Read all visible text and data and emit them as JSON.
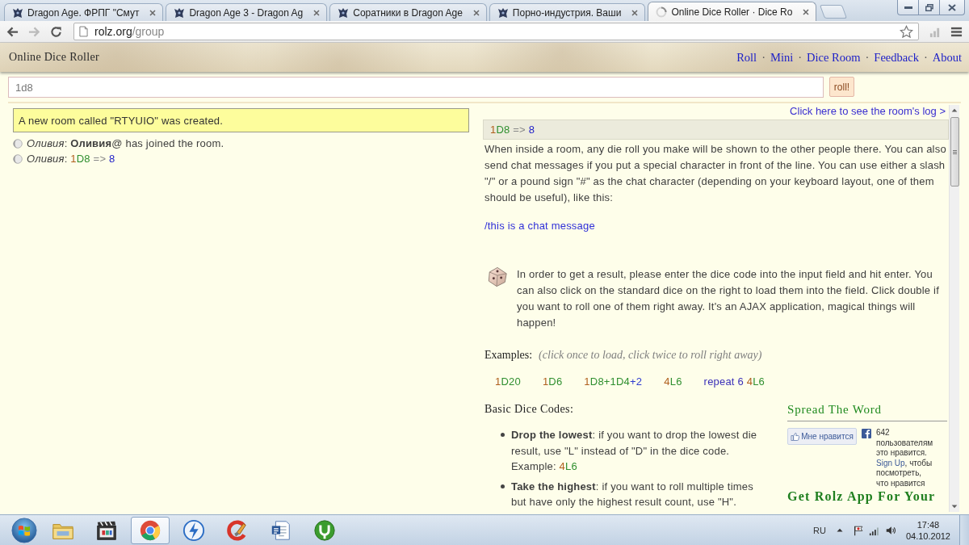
{
  "browser": {
    "tabs": [
      {
        "title": "Dragon Age. ФРПГ \"Смут",
        "selected": false,
        "loading": false
      },
      {
        "title": "Dragon Age 3 - Dragon Ag",
        "selected": false,
        "loading": false
      },
      {
        "title": "Соратники в Dragon Age",
        "selected": false,
        "loading": false
      },
      {
        "title": "Порно-индустрия. Ваши",
        "selected": false,
        "loading": false
      },
      {
        "title": "Online Dice Roller · Dice Ro",
        "selected": true,
        "loading": true
      }
    ],
    "back": {
      "disabled": false
    },
    "forward": {
      "disabled": true
    },
    "url": {
      "host": "rolz.org",
      "path": "/group"
    }
  },
  "header": {
    "title": "Online Dice Roller",
    "nav": [
      {
        "kind": "link",
        "label": "Roll"
      },
      {
        "kind": "separator",
        "label": "·"
      },
      {
        "kind": "link",
        "label": "Mini"
      },
      {
        "kind": "separator",
        "label": "·"
      },
      {
        "kind": "link",
        "label": "Dice Room"
      },
      {
        "kind": "separator",
        "label": "·"
      },
      {
        "kind": "link",
        "label": "Feedback"
      },
      {
        "kind": "separator",
        "label": "·"
      },
      {
        "kind": "link",
        "label": "About"
      }
    ]
  },
  "roll_form": {
    "value": "1d8",
    "button": "roll!"
  },
  "room_log": {
    "notice": "A new room called \"RTYUIO\" was created.",
    "entries": [
      {
        "kind": "join",
        "text": "*Оливия*: **Оливия**@ has joined the room."
      },
      {
        "kind": "roll",
        "prefix": "*Оливия*:",
        "tokens": [
          {
            "kind": "count",
            "text": "1"
          },
          {
            "kind": "die",
            "text": "D8"
          },
          {
            "kind": "operator",
            "text": " => "
          },
          {
            "kind": "result",
            "text": "8"
          }
        ]
      }
    ]
  },
  "info": {
    "log_link": "Click here to see the room's log >",
    "last_roll": [
      {
        "kind": "count",
        "text": "1"
      },
      {
        "kind": "die",
        "text": "D8"
      },
      {
        "kind": "operator",
        "text": " => "
      },
      {
        "kind": "result",
        "text": "8"
      }
    ],
    "intro": "When inside a room, any die roll you make will be shown to the other people there. You can also send chat messages if you put a special character in front of the line. You can use either a slash \"/\" or a pound sign \"#\" as the chat character (depending on your keyboard layout, one of them should be useful), like this:",
    "chat_example": "/this is a chat message",
    "howto": "In order to get a result, please enter the dice code into the input field and hit enter. You can also click on the standard dice on the right to load them into the field. Click double if you want to roll one of them right away. It's an AJAX application, magical things will happen!",
    "examples_label": "Examples:",
    "examples_hint": "(click once to load, click twice to roll right away)",
    "examples": [
      [
        {
          "kind": "count",
          "text": "1"
        },
        {
          "kind": "die",
          "text": "D20"
        }
      ],
      [
        {
          "kind": "count",
          "text": "1"
        },
        {
          "kind": "die",
          "text": "D6"
        }
      ],
      [
        {
          "kind": "count",
          "text": "1"
        },
        {
          "kind": "die",
          "text": "D8+1D4"
        },
        {
          "kind": "modifier",
          "text": "+2"
        }
      ],
      [
        {
          "kind": "count",
          "text": "4"
        },
        {
          "kind": "die",
          "text": "L6"
        }
      ],
      [
        {
          "kind": "keyword",
          "text": "repeat 6 "
        },
        {
          "kind": "count",
          "text": "4"
        },
        {
          "kind": "die",
          "text": "L6"
        }
      ]
    ],
    "codes_heading": "Basic Dice Codes:",
    "codes": [
      {
        "text": "**Drop the lowest**: if you want to drop the lowest die result, use \"L\" instead of \"D\" in the dice code.",
        "example_label": "Example:",
        "example": [
          {
            "kind": "count",
            "text": "4"
          },
          {
            "kind": "die",
            "text": "L6"
          }
        ]
      },
      {
        "text": "**Take the highest**: if you want to roll multiple times but have only the highest result count, use \"H\"."
      }
    ]
  },
  "sidebar": {
    "heading": "Spread The Word",
    "like_button": "Мне нравится",
    "like_text": "642 пользователям это нравится.",
    "signup_link": "Sign Up",
    "signup_text": ", чтобы посмотреть, что нравится",
    "app_heading": "Get Rolz App For Your"
  },
  "taskbar": {
    "apps": [
      {
        "kind": "folder",
        "selected": false
      },
      {
        "kind": "media",
        "selected": false
      },
      {
        "kind": "browser",
        "selected": true
      },
      {
        "kind": "lightning",
        "selected": false
      },
      {
        "kind": "cleaner",
        "selected": false
      },
      {
        "kind": "document",
        "selected": false
      },
      {
        "kind": "torrent",
        "selected": false
      }
    ],
    "language": "RU",
    "time": "17:48",
    "date": "04.10.2012"
  }
}
